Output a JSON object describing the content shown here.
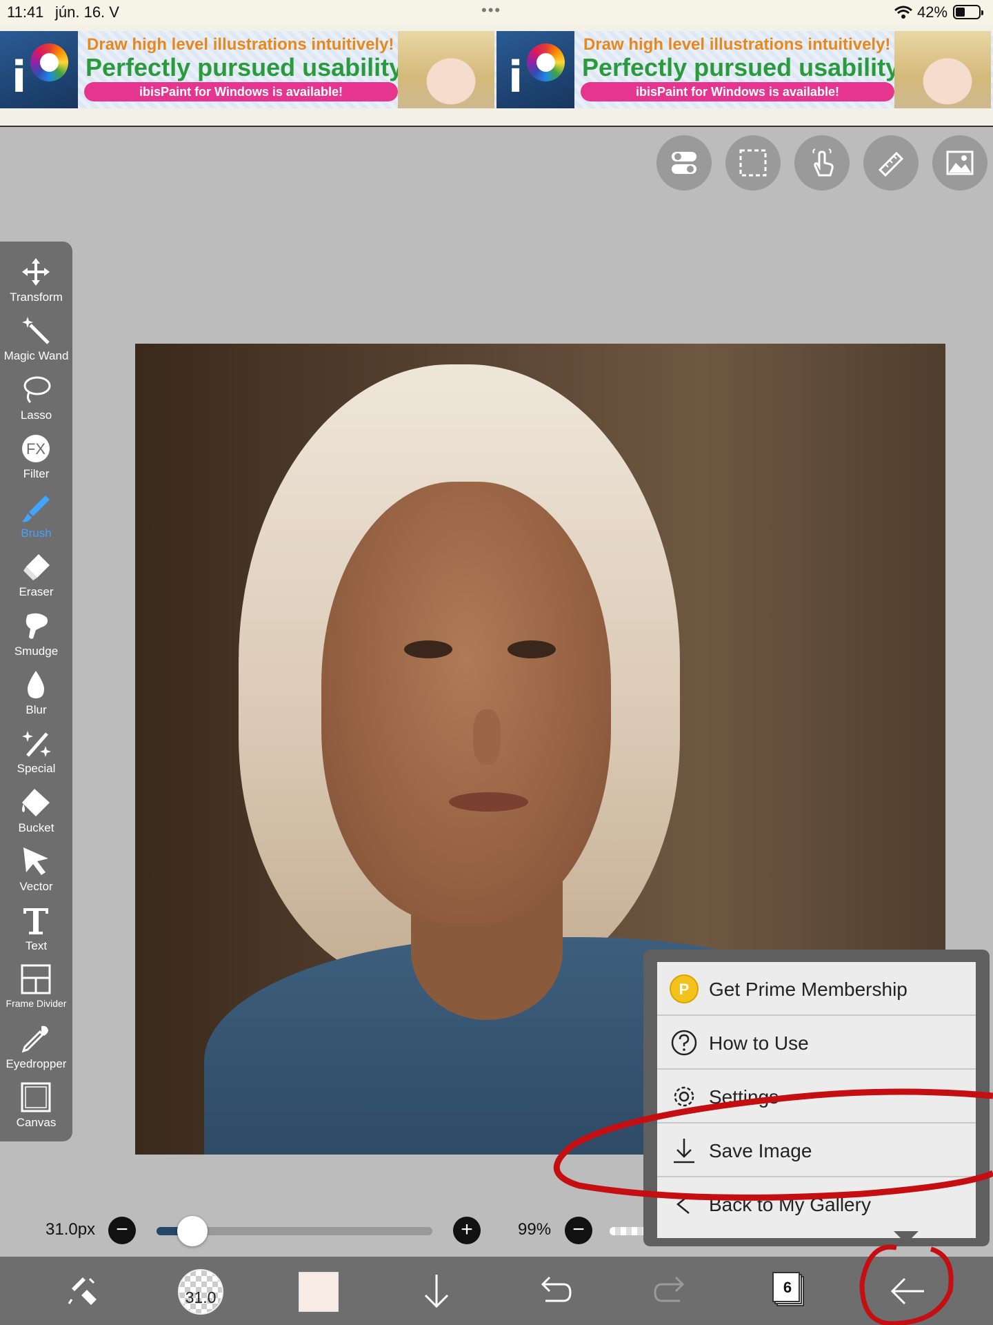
{
  "status_bar": {
    "time": "11:41",
    "date": "jún. 16. V",
    "dots": "•••",
    "battery": "42%",
    "battery_level": 0.42
  },
  "ads": [
    {
      "line1": "Draw high level illustrations intuitively!",
      "line2": "Perfectly pursued usability!",
      "line3": "ibisPaint for Windows is available!"
    },
    {
      "line1": "Draw high level illustrations intuitively!",
      "line2": "Perfectly pursued usability!",
      "line3": "ibisPaint for Windows is available!"
    }
  ],
  "top_tools": [
    "toggle-icon",
    "selection-icon",
    "touch-icon",
    "ruler-icon",
    "image-icon"
  ],
  "tools": [
    {
      "label": "Transform",
      "icon": "transform-icon"
    },
    {
      "label": "Magic Wand",
      "icon": "magic-wand-icon"
    },
    {
      "label": "Lasso",
      "icon": "lasso-icon"
    },
    {
      "label": "Filter",
      "icon": "fx-icon"
    },
    {
      "label": "Brush",
      "icon": "brush-icon",
      "active": true
    },
    {
      "label": "Eraser",
      "icon": "eraser-icon"
    },
    {
      "label": "Smudge",
      "icon": "smudge-icon"
    },
    {
      "label": "Blur",
      "icon": "blur-icon"
    },
    {
      "label": "Special",
      "icon": "special-icon"
    },
    {
      "label": "Bucket",
      "icon": "bucket-icon"
    },
    {
      "label": "Vector",
      "icon": "vector-icon"
    },
    {
      "label": "Text",
      "icon": "text-icon"
    },
    {
      "label": "Frame Divider",
      "icon": "frame-divider-icon"
    },
    {
      "label": "Eyedropper",
      "icon": "eyedropper-icon"
    },
    {
      "label": "Canvas",
      "icon": "canvas-icon"
    }
  ],
  "fx_text": "FX",
  "brush_size": {
    "label": "31.0px",
    "minus": "−",
    "plus": "+",
    "level": 0.13
  },
  "opacity": {
    "label": "99%",
    "minus": "−"
  },
  "bottom_bar": {
    "brush_preview": "31.0",
    "color": "#f8ebe6",
    "layers": "6"
  },
  "menu": [
    {
      "label": "Get Prime Membership",
      "icon": "prime-icon",
      "badge": "P"
    },
    {
      "label": "How to Use",
      "icon": "help-icon"
    },
    {
      "label": "Settings",
      "icon": "gear-icon"
    },
    {
      "label": "Save Image",
      "icon": "download-icon"
    },
    {
      "label": "Back to My Gallery",
      "icon": "chevron-left-icon"
    }
  ],
  "colors": {
    "accent": "#41a4ff",
    "annotation": "#c40e12",
    "toolbar": "#6e6e6e"
  }
}
